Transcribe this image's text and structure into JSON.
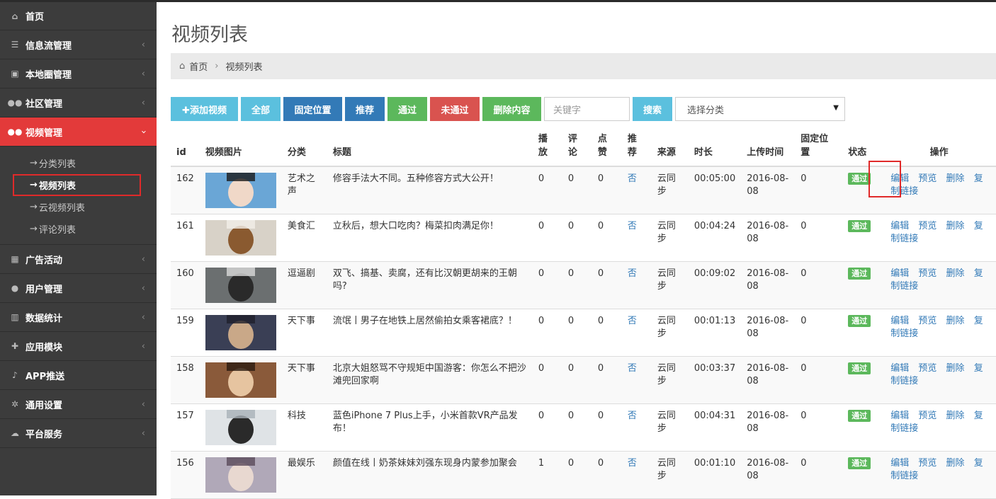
{
  "sidebar": {
    "items": [
      {
        "label": "首页",
        "icon": "home-icon"
      },
      {
        "label": "信息流管理",
        "icon": "list-icon"
      },
      {
        "label": "本地圈管理",
        "icon": "camera-icon"
      },
      {
        "label": "社区管理",
        "icon": "users-icon"
      },
      {
        "label": "视频管理",
        "icon": "users-icon"
      },
      {
        "label": "广告活动",
        "icon": "calendar-icon"
      },
      {
        "label": "用户管理",
        "icon": "user-icon"
      },
      {
        "label": "数据统计",
        "icon": "bar-chart-icon"
      },
      {
        "label": "应用模块",
        "icon": "puzzle-icon"
      },
      {
        "label": "APP推送",
        "icon": "bell-icon"
      },
      {
        "label": "通用设置",
        "icon": "gears-icon"
      },
      {
        "label": "平台服务",
        "icon": "cloud-icon"
      }
    ],
    "submenu": [
      "分类列表",
      "视频列表",
      "云视频列表",
      "评论列表"
    ],
    "arrow": "→",
    "chevron": "‹",
    "chevron_open": "›",
    "accent": "#e33a3a"
  },
  "page": {
    "title": "视频列表"
  },
  "breadcrumb": {
    "home": "首页",
    "sep": "›",
    "current": "视频列表"
  },
  "toolbar": {
    "add": "✚添加视频",
    "all": "全部",
    "fixed": "固定位置",
    "recommend": "推荐",
    "pass": "通过",
    "fail": "未通过",
    "delete": "删除内容",
    "keyword_placeholder": "关键字",
    "search": "搜索",
    "category": "选择分类"
  },
  "table": {
    "headers": {
      "id": "id",
      "thumb": "视频图片",
      "category": "分类",
      "title": "标题",
      "plays": "播放",
      "comments": "评论",
      "likes": "点赞",
      "recommend": "推荐",
      "source": "来源",
      "duration": "时长",
      "upload": "上传时间",
      "fixed": "固定位置",
      "status": "状态",
      "ops": "操作"
    },
    "op_labels": {
      "edit": "编辑",
      "preview": "预览",
      "delete": "删除",
      "copy": "复制链接"
    },
    "rows": [
      {
        "id": "162",
        "category": "艺术之声",
        "title": "修容手法大不同。五种修容方式大公开！",
        "plays": "0",
        "comments": "0",
        "likes": "0",
        "recommend": "否",
        "source": "云同步",
        "duration": "00:05:00",
        "upload": "2016-08-08",
        "fixed": "0",
        "status": "通过"
      },
      {
        "id": "161",
        "category": "美食汇",
        "title": "立秋后，想大口吃肉？梅菜扣肉满足你！",
        "plays": "0",
        "comments": "0",
        "likes": "0",
        "recommend": "否",
        "source": "云同步",
        "duration": "00:04:24",
        "upload": "2016-08-08",
        "fixed": "0",
        "status": "通过"
      },
      {
        "id": "160",
        "category": "逗逼剧",
        "title": "双飞、搞基、卖腐，还有比汉朝更胡来的王朝吗?",
        "plays": "0",
        "comments": "0",
        "likes": "0",
        "recommend": "否",
        "source": "云同步",
        "duration": "00:09:02",
        "upload": "2016-08-08",
        "fixed": "0",
        "status": "通过"
      },
      {
        "id": "159",
        "category": "天下事",
        "title": "流氓丨男子在地铁上居然偷拍女乘客裙底？！",
        "plays": "0",
        "comments": "0",
        "likes": "0",
        "recommend": "否",
        "source": "云同步",
        "duration": "00:01:13",
        "upload": "2016-08-08",
        "fixed": "0",
        "status": "通过"
      },
      {
        "id": "158",
        "category": "天下事",
        "title": "北京大姐怒骂不守规矩中国游客：你怎么不把沙滩兜回家啊",
        "plays": "0",
        "comments": "0",
        "likes": "0",
        "recommend": "否",
        "source": "云同步",
        "duration": "00:03:37",
        "upload": "2016-08-08",
        "fixed": "0",
        "status": "通过"
      },
      {
        "id": "157",
        "category": "科技",
        "title": "蓝色iPhone 7 Plus上手，小米首款VR产品发布！",
        "plays": "0",
        "comments": "0",
        "likes": "0",
        "recommend": "否",
        "source": "云同步",
        "duration": "00:04:31",
        "upload": "2016-08-08",
        "fixed": "0",
        "status": "通过"
      },
      {
        "id": "156",
        "category": "最娱乐",
        "title": "颜值在线丨奶茶妹妹刘强东现身内蒙参加聚会",
        "plays": "1",
        "comments": "0",
        "likes": "0",
        "recommend": "否",
        "source": "云同步",
        "duration": "00:01:10",
        "upload": "2016-08-08",
        "fixed": "0",
        "status": "通过"
      }
    ]
  }
}
